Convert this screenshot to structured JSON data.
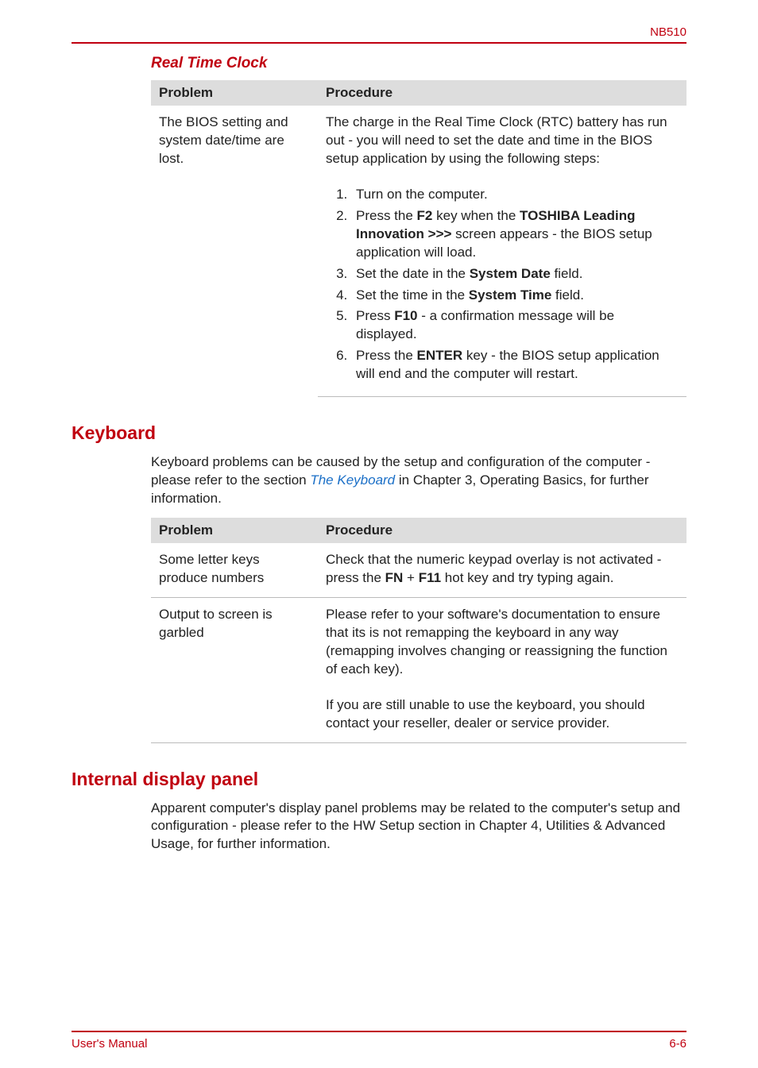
{
  "header": {
    "doc_id": "NB510"
  },
  "rtc": {
    "heading": "Real Time Clock",
    "th_problem": "Problem",
    "th_procedure": "Procedure",
    "problem": "The BIOS setting and system date/time are lost.",
    "procedure_intro": "The charge in the Real Time Clock (RTC) battery has run out - you will need to set the date and time in the BIOS setup application by using the following steps:",
    "steps": {
      "s1": "Turn on the computer.",
      "s2_a": "Press the ",
      "s2_b": "F2",
      "s2_c": " key when the ",
      "s2_d": "TOSHIBA Leading Innovation >>>",
      "s2_e": " screen appears - the BIOS setup application will load.",
      "s3_a": "Set the date in the ",
      "s3_b": "System Date",
      "s3_c": " field.",
      "s4_a": "Set the time in the ",
      "s4_b": "System Time",
      "s4_c": " field.",
      "s5_a": "Press ",
      "s5_b": "F10",
      "s5_c": " - a confirmation message will be displayed.",
      "s6_a": "Press the ",
      "s6_b": "ENTER",
      "s6_c": " key - the BIOS setup application will end and the computer will restart."
    }
  },
  "keyboard": {
    "heading": "Keyboard",
    "intro_a": "Keyboard problems can be caused by the setup and configuration of the computer - please refer to the section ",
    "intro_link": "The Keyboard",
    "intro_b": " in Chapter 3, Operating Basics, for further information.",
    "th_problem": "Problem",
    "th_procedure": "Procedure",
    "row1": {
      "problem": "Some letter keys produce numbers",
      "proc_a": "Check that the numeric keypad overlay is not activated - press the ",
      "proc_b": "FN",
      "proc_c": " + ",
      "proc_d": "F11",
      "proc_e": " hot key and try typing again."
    },
    "row2": {
      "problem": "Output to screen is garbled",
      "proc": "Please refer to your software's documentation to ensure that its is not remapping the keyboard in any way (remapping involves changing or reassigning the function of each key)."
    },
    "row3": {
      "proc": "If you are still unable to use the keyboard, you should contact your reseller, dealer or service provider."
    }
  },
  "display": {
    "heading": "Internal display panel",
    "intro": "Apparent computer's display panel problems may be related to the computer's setup and configuration - please refer to the HW Setup section in Chapter 4, Utilities & Advanced Usage, for further information."
  },
  "footer": {
    "left": "User's Manual",
    "right": "6-6"
  }
}
